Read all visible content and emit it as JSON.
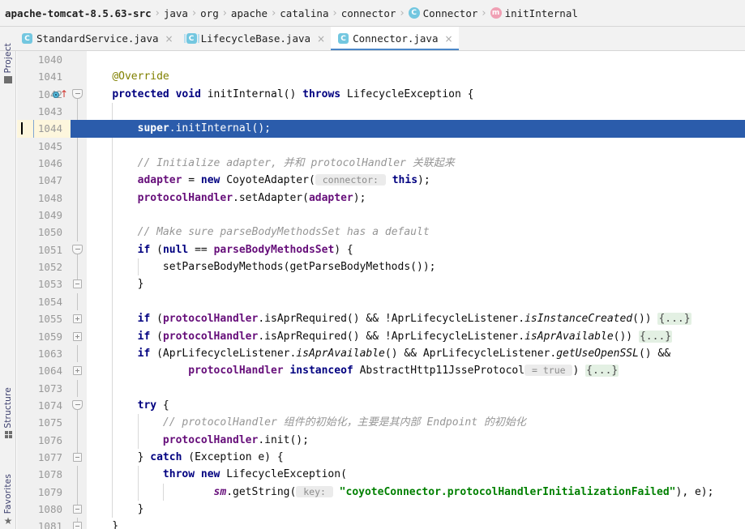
{
  "breadcrumb": {
    "name": "breadcrumb",
    "items": [
      {
        "label": "apache-tomcat-8.5.63-src",
        "bold": true,
        "icon": null
      },
      {
        "label": "java",
        "bold": false,
        "icon": null
      },
      {
        "label": "org",
        "bold": false,
        "icon": null
      },
      {
        "label": "apache",
        "bold": false,
        "icon": null
      },
      {
        "label": "catalina",
        "bold": false,
        "icon": null
      },
      {
        "label": "connector",
        "bold": false,
        "icon": null
      },
      {
        "label": "Connector",
        "bold": false,
        "icon": "class-icon",
        "icon_glyph": "C"
      },
      {
        "label": "initInternal",
        "bold": false,
        "icon": "method-icon",
        "icon_glyph": "m"
      }
    ],
    "separator": "›"
  },
  "tabs": [
    {
      "label": "StandardService.java",
      "icon_glyph": "C",
      "icon_kind": "class-icon",
      "active": false,
      "close_glyph": "×"
    },
    {
      "label": "LifecycleBase.java",
      "icon_glyph": "C",
      "icon_kind": "abstract-class-icon",
      "active": false,
      "close_glyph": "×"
    },
    {
      "label": "Connector.java",
      "icon_glyph": "C",
      "icon_kind": "class-icon",
      "active": true,
      "close_glyph": "×"
    }
  ],
  "tool_strip": [
    {
      "label": "Project",
      "icon": "block-icon"
    },
    {
      "label": "Structure",
      "icon": "grid-icon"
    },
    {
      "label": "Favorites",
      "icon": "star-icon"
    }
  ],
  "colors": {
    "selection_blue": "#2b5cab",
    "current_line_yellow": "#fdf6dd",
    "keyword_navy": "#000080",
    "field_purple": "#660e7a",
    "string_green": "#008000",
    "comment_gray": "#969696",
    "annotation_olive": "#808000",
    "fold_placeholder_green": "#e3f0e3",
    "tab_underline": "#4a86c8",
    "class_icon_cyan": "#73c7e0",
    "method_icon_pink": "#f0a0b4"
  },
  "editor": {
    "file": "Connector.java",
    "first_visible_line": 1040,
    "current_line": 1044,
    "lines": [
      {
        "n": 1040,
        "fold": null,
        "marks": null,
        "indent": [],
        "selected": false,
        "tokens": []
      },
      {
        "n": 1041,
        "fold": null,
        "marks": null,
        "indent": [],
        "selected": false,
        "tokens": [
          {
            "t": "    ",
            "c": ""
          },
          {
            "t": "@Override",
            "c": "anno"
          }
        ]
      },
      {
        "n": 1042,
        "fold": "start",
        "marks": "override",
        "indent": [],
        "selected": false,
        "tokens": [
          {
            "t": "    ",
            "c": ""
          },
          {
            "t": "protected",
            "c": "kw"
          },
          {
            "t": " ",
            "c": ""
          },
          {
            "t": "void",
            "c": "kw"
          },
          {
            "t": " initInternal() ",
            "c": ""
          },
          {
            "t": "throws",
            "c": "kw"
          },
          {
            "t": " LifecycleException {",
            "c": ""
          }
        ]
      },
      {
        "n": 1043,
        "fold": null,
        "marks": null,
        "indent": [
          1
        ],
        "selected": false,
        "tokens": []
      },
      {
        "n": 1044,
        "fold": null,
        "marks": null,
        "indent": [],
        "selected": true,
        "tokens": [
          {
            "t": "        ",
            "c": ""
          },
          {
            "t": "super",
            "c": "kwsel"
          },
          {
            "t": ".initInternal();",
            "c": ""
          }
        ]
      },
      {
        "n": 1045,
        "fold": null,
        "marks": null,
        "indent": [
          1
        ],
        "selected": false,
        "tokens": []
      },
      {
        "n": 1046,
        "fold": null,
        "marks": null,
        "indent": [
          1
        ],
        "selected": false,
        "tokens": [
          {
            "t": "        ",
            "c": ""
          },
          {
            "t": "// Initialize adapter, 并和 protocolHandler 关联起来",
            "c": "cmt"
          }
        ]
      },
      {
        "n": 1047,
        "fold": null,
        "marks": null,
        "indent": [
          1
        ],
        "selected": false,
        "tokens": [
          {
            "t": "        ",
            "c": ""
          },
          {
            "t": "adapter",
            "c": "fld"
          },
          {
            "t": " = ",
            "c": ""
          },
          {
            "t": "new",
            "c": "kw"
          },
          {
            "t": " CoyoteAdapter(",
            "c": ""
          },
          {
            "t": " connector: ",
            "c": "hint"
          },
          {
            "t": " ",
            "c": ""
          },
          {
            "t": "this",
            "c": "kw"
          },
          {
            "t": ");",
            "c": ""
          }
        ]
      },
      {
        "n": 1048,
        "fold": null,
        "marks": null,
        "indent": [
          1
        ],
        "selected": false,
        "tokens": [
          {
            "t": "        ",
            "c": ""
          },
          {
            "t": "protocolHandler",
            "c": "fld"
          },
          {
            "t": ".setAdapter(",
            "c": ""
          },
          {
            "t": "adapter",
            "c": "fld"
          },
          {
            "t": ");",
            "c": ""
          }
        ]
      },
      {
        "n": 1049,
        "fold": null,
        "marks": null,
        "indent": [
          1
        ],
        "selected": false,
        "tokens": []
      },
      {
        "n": 1050,
        "fold": null,
        "marks": null,
        "indent": [
          1
        ],
        "selected": false,
        "tokens": [
          {
            "t": "        ",
            "c": ""
          },
          {
            "t": "// Make sure parseBodyMethodsSet has a default",
            "c": "cmt"
          }
        ]
      },
      {
        "n": 1051,
        "fold": "start",
        "marks": null,
        "indent": [
          1
        ],
        "selected": false,
        "tokens": [
          {
            "t": "        ",
            "c": ""
          },
          {
            "t": "if",
            "c": "kw"
          },
          {
            "t": " (",
            "c": ""
          },
          {
            "t": "null",
            "c": "kw"
          },
          {
            "t": " == ",
            "c": ""
          },
          {
            "t": "parseBodyMethodsSet",
            "c": "fld"
          },
          {
            "t": ") {",
            "c": ""
          }
        ]
      },
      {
        "n": 1052,
        "fold": null,
        "marks": null,
        "indent": [
          1,
          2
        ],
        "selected": false,
        "tokens": [
          {
            "t": "            setParseBodyMethods(getParseBodyMethods());",
            "c": ""
          }
        ]
      },
      {
        "n": 1053,
        "fold": "end",
        "marks": null,
        "indent": [
          1
        ],
        "selected": false,
        "tokens": [
          {
            "t": "        }",
            "c": ""
          }
        ]
      },
      {
        "n": 1054,
        "fold": null,
        "marks": null,
        "indent": [
          1
        ],
        "selected": false,
        "tokens": []
      },
      {
        "n": 1055,
        "fold": "plus",
        "marks": null,
        "indent": [
          1
        ],
        "selected": false,
        "tokens": [
          {
            "t": "        ",
            "c": ""
          },
          {
            "t": "if",
            "c": "kw"
          },
          {
            "t": " (",
            "c": ""
          },
          {
            "t": "protocolHandler",
            "c": "fld"
          },
          {
            "t": ".isAprRequired() && !AprLifecycleListener.",
            "c": ""
          },
          {
            "t": "isInstanceCreated",
            "c": "smeth"
          },
          {
            "t": "()) ",
            "c": ""
          },
          {
            "t": "{...}",
            "c": "fold-ph"
          }
        ]
      },
      {
        "n": 1059,
        "fold": "plus",
        "marks": null,
        "indent": [
          1
        ],
        "selected": false,
        "tokens": [
          {
            "t": "        ",
            "c": ""
          },
          {
            "t": "if",
            "c": "kw"
          },
          {
            "t": " (",
            "c": ""
          },
          {
            "t": "protocolHandler",
            "c": "fld"
          },
          {
            "t": ".isAprRequired() && !AprLifecycleListener.",
            "c": ""
          },
          {
            "t": "isAprAvailable",
            "c": "smeth"
          },
          {
            "t": "()) ",
            "c": ""
          },
          {
            "t": "{...}",
            "c": "fold-ph"
          }
        ]
      },
      {
        "n": 1063,
        "fold": null,
        "marks": null,
        "indent": [
          1
        ],
        "selected": false,
        "tokens": [
          {
            "t": "        ",
            "c": ""
          },
          {
            "t": "if",
            "c": "kw"
          },
          {
            "t": " (AprLifecycleListener.",
            "c": ""
          },
          {
            "t": "isAprAvailable",
            "c": "smeth"
          },
          {
            "t": "() && AprLifecycleListener.",
            "c": ""
          },
          {
            "t": "getUseOpenSSL",
            "c": "smeth"
          },
          {
            "t": "() &&",
            "c": ""
          }
        ]
      },
      {
        "n": 1064,
        "fold": "plus",
        "marks": null,
        "indent": [
          1
        ],
        "selected": false,
        "tokens": [
          {
            "t": "                ",
            "c": ""
          },
          {
            "t": "protocolHandler",
            "c": "fld"
          },
          {
            "t": " ",
            "c": ""
          },
          {
            "t": "instanceof",
            "c": "kw"
          },
          {
            "t": " AbstractHttp11JsseProtocol",
            "c": ""
          },
          {
            "t": " = true ",
            "c": "hint"
          },
          {
            "t": ") ",
            "c": ""
          },
          {
            "t": "{...}",
            "c": "fold-ph"
          }
        ]
      },
      {
        "n": 1073,
        "fold": null,
        "marks": null,
        "indent": [
          1
        ],
        "selected": false,
        "tokens": []
      },
      {
        "n": 1074,
        "fold": "start",
        "marks": null,
        "indent": [
          1
        ],
        "selected": false,
        "tokens": [
          {
            "t": "        ",
            "c": ""
          },
          {
            "t": "try",
            "c": "kw"
          },
          {
            "t": " {",
            "c": ""
          }
        ]
      },
      {
        "n": 1075,
        "fold": null,
        "marks": null,
        "indent": [
          1,
          2
        ],
        "selected": false,
        "tokens": [
          {
            "t": "            ",
            "c": ""
          },
          {
            "t": "// protocolHandler 组件的初始化，主要是其内部 Endpoint 的初始化",
            "c": "cmt"
          }
        ]
      },
      {
        "n": 1076,
        "fold": null,
        "marks": null,
        "indent": [
          1,
          2
        ],
        "selected": false,
        "tokens": [
          {
            "t": "            ",
            "c": ""
          },
          {
            "t": "protocolHandler",
            "c": "fld"
          },
          {
            "t": ".init();",
            "c": ""
          }
        ]
      },
      {
        "n": 1077,
        "fold": "end",
        "marks": null,
        "indent": [
          1
        ],
        "selected": false,
        "tokens": [
          {
            "t": "        } ",
            "c": ""
          },
          {
            "t": "catch",
            "c": "kw"
          },
          {
            "t": " (Exception e) {",
            "c": ""
          }
        ]
      },
      {
        "n": 1078,
        "fold": null,
        "marks": null,
        "indent": [
          1,
          2
        ],
        "selected": false,
        "tokens": [
          {
            "t": "            ",
            "c": ""
          },
          {
            "t": "throw",
            "c": "kw"
          },
          {
            "t": " ",
            "c": ""
          },
          {
            "t": "new",
            "c": "kw"
          },
          {
            "t": " LifecycleException(",
            "c": ""
          }
        ]
      },
      {
        "n": 1079,
        "fold": null,
        "marks": null,
        "indent": [
          1,
          2,
          3
        ],
        "selected": false,
        "tokens": [
          {
            "t": "                    ",
            "c": ""
          },
          {
            "t": "sm",
            "c": "stat"
          },
          {
            "t": ".getString(",
            "c": ""
          },
          {
            "t": " key: ",
            "c": "hint"
          },
          {
            "t": " ",
            "c": ""
          },
          {
            "t": "\"coyoteConnector.protocolHandlerInitializationFailed\"",
            "c": "str"
          },
          {
            "t": "), e);",
            "c": ""
          }
        ]
      },
      {
        "n": 1080,
        "fold": "end",
        "marks": null,
        "indent": [
          1
        ],
        "selected": false,
        "tokens": [
          {
            "t": "        }",
            "c": ""
          }
        ]
      },
      {
        "n": 1081,
        "fold": "end",
        "marks": null,
        "indent": [],
        "selected": false,
        "tokens": [
          {
            "t": "    }",
            "c": ""
          }
        ]
      }
    ]
  }
}
